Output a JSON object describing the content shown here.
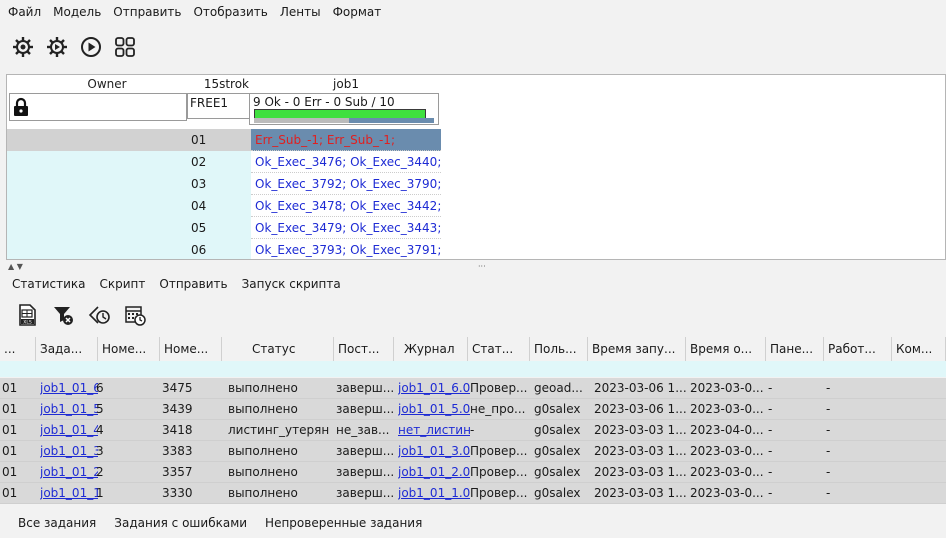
{
  "menu": [
    "Файл",
    "Модель",
    "Отправить",
    "Отобразить",
    "Ленты",
    "Формат"
  ],
  "toolbar_icons": [
    "gear-icon",
    "gear-alt-icon",
    "play-icon",
    "grid-icon"
  ],
  "upper": {
    "header_owner": "Owner",
    "header_15strok": "15strok",
    "header_job": "job1",
    "free": "FREE1",
    "job_summary": "9 Ok - 0 Err - 0 Sub / 10",
    "progress_ok_fraction": 0.9,
    "rows": [
      {
        "num": "01",
        "text": "Err_Sub_-1; Err_Sub_-1;"
      },
      {
        "num": "02",
        "text": "Ok_Exec_3476; Ok_Exec_3440;"
      },
      {
        "num": "03",
        "text": "Ok_Exec_3792; Ok_Exec_3790;"
      },
      {
        "num": "04",
        "text": "Ok_Exec_3478; Ok_Exec_3442;"
      },
      {
        "num": "05",
        "text": "Ok_Exec_3479; Ok_Exec_3443;"
      },
      {
        "num": "06",
        "text": "Ok_Exec_3793; Ok_Exec_3791;"
      }
    ]
  },
  "tabs": [
    "Статистика",
    "Скрипт",
    "Отправить",
    "Запуск скрипта"
  ],
  "toolbar2_icons": [
    "excel-export-icon",
    "filter-clear-icon",
    "back-refresh-icon",
    "calendar-refresh-icon"
  ],
  "table": {
    "columns": [
      "...",
      "Зада...",
      "Номе...",
      "Номе...",
      "Статус",
      "Пост...",
      "Журнал",
      "Стат...",
      "Поль...",
      "Время запу...",
      "Время о...",
      "Пане...",
      "Работ...",
      "Ком..."
    ],
    "rows": [
      [
        "01",
        "job1_01_6",
        "6",
        "3475",
        "выполнено",
        "заверш...",
        "job1_01_6.0",
        "Провер...",
        "geoad...",
        "2023-03-06 1...",
        "2023-03-0...",
        "-",
        "-",
        ""
      ],
      [
        "01",
        "job1_01_5",
        "5",
        "3439",
        "выполнено",
        "заверш...",
        "job1_01_5.0",
        "не_про...",
        "g0salex",
        "2023-03-06 1...",
        "2023-03-0...",
        "-",
        "-",
        ""
      ],
      [
        "01",
        "job1_01_4",
        "4",
        "3418",
        "листинг_утерян",
        "не_зав...",
        "нет_листин",
        "-",
        "g0salex",
        "2023-03-03 1...",
        "2023-04-0...",
        "-",
        "-",
        ""
      ],
      [
        "01",
        "job1_01_3",
        "3",
        "3383",
        "выполнено",
        "заверш...",
        "job1_01_3.0",
        "Провер...",
        "g0salex",
        "2023-03-03 1...",
        "2023-03-0...",
        "-",
        "-",
        ""
      ],
      [
        "01",
        "job1_01_2",
        "2",
        "3357",
        "выполнено",
        "заверш...",
        "job1_01_2.0",
        "Провер...",
        "g0salex",
        "2023-03-03 1...",
        "2023-03-0...",
        "-",
        "-",
        ""
      ],
      [
        "01",
        "job1_01_1",
        "1",
        "3330",
        "выполнено",
        "заверш...",
        "job1_01_1.0",
        "Провер...",
        "g0salex",
        "2023-03-03 1...",
        "2023-03-0...",
        "-",
        "-",
        ""
      ]
    ]
  },
  "bottom_tabs": [
    "Все задания",
    "Задания с ошибками",
    "Непроверенные задания"
  ],
  "colors": {
    "selected": "#6a8cae",
    "cyan": "#e0f7f9",
    "link": "#1e2bd4",
    "error": "#e02020",
    "progress": "#3fe03f"
  }
}
